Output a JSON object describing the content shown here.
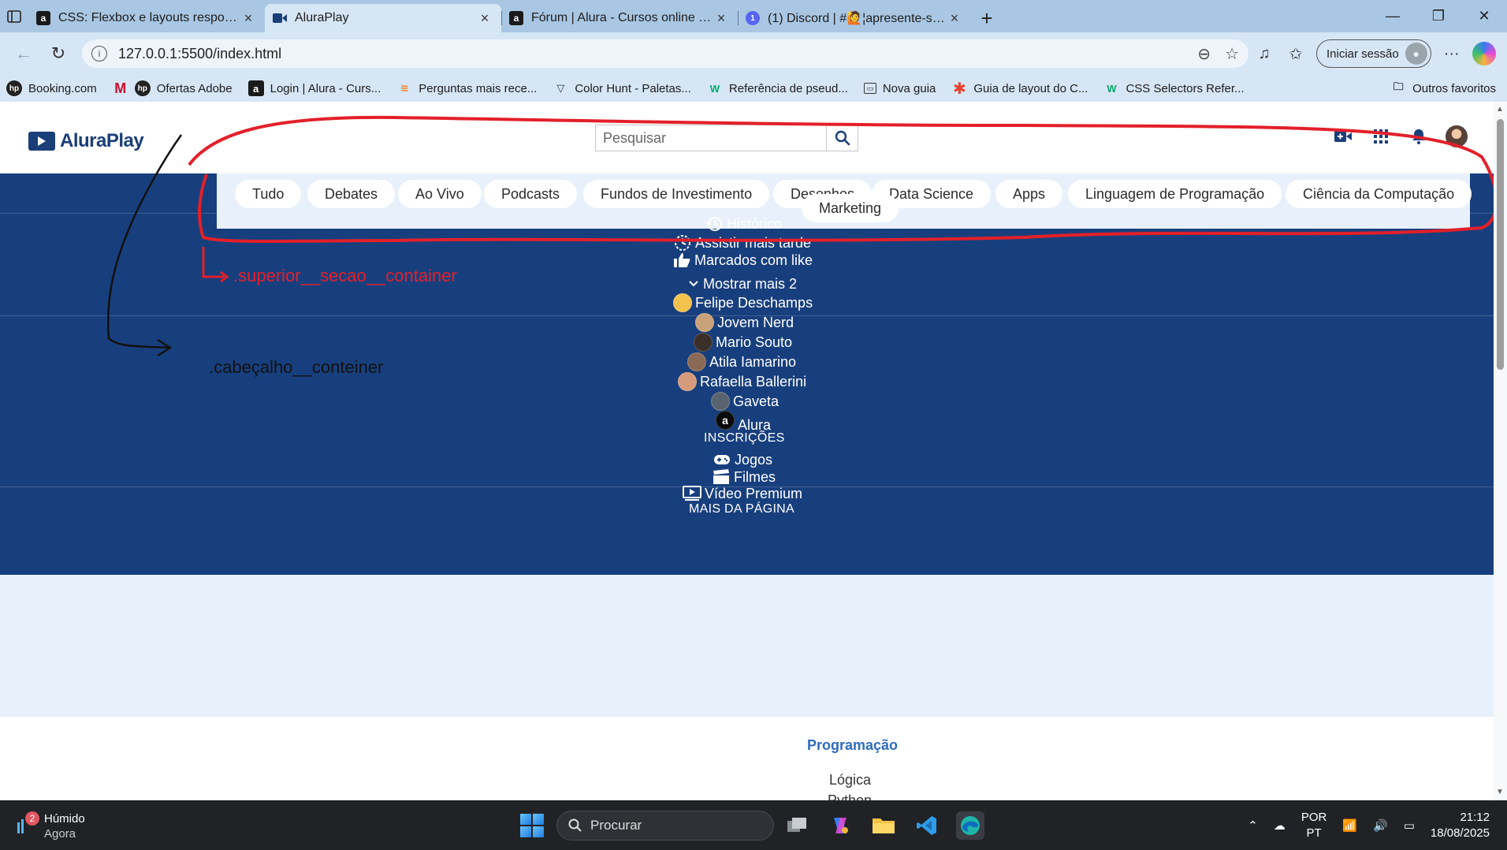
{
  "browser": {
    "tabs": [
      {
        "title": "CSS: Flexbox e layouts responsivo",
        "favicon": "alura-a-icon",
        "active": false
      },
      {
        "title": "AluraPlay",
        "favicon": "aluraplay-icon",
        "active": true
      },
      {
        "title": "Fórum | Alura - Cursos online de t",
        "favicon": "alura-a-icon",
        "active": false
      },
      {
        "title": "(1) Discord | #🙋¦apresente-se | A",
        "favicon": "discord-icon",
        "active": false
      }
    ],
    "url": "127.0.0.1:5500/index.html",
    "signin_label": "Iniciar sessão",
    "bookmarks": [
      {
        "label": "Booking.com",
        "icon": "hp-icon"
      },
      {
        "label": "Ofertas Adobe",
        "icon": "mcafee-icon"
      },
      {
        "label": "Login | Alura - Curs...",
        "icon": "hp-icon"
      },
      {
        "label": "Perguntas mais rece...",
        "icon": "alura-a-icon"
      },
      {
        "label": "Color Hunt - Paletas...",
        "icon": "stackoverflow-icon"
      },
      {
        "label": "Referência de pseud...",
        "icon": "colorhunt-icon"
      },
      {
        "label": "Nova guia",
        "icon": "w3schools-icon"
      },
      {
        "label": "Guia de layout do C...",
        "icon": "newtab-icon"
      },
      {
        "label": "CSS Selectors Refer...",
        "icon": "asterisk-icon"
      }
    ],
    "bookmarks_extra": {
      "label": "CSS Selectors Refer...",
      "icon": "w3schools-icon"
    },
    "other_favorites": "Outros favoritos"
  },
  "page": {
    "logo_text": "AluraPlay",
    "search_placeholder": "Pesquisar",
    "categories": [
      "Tudo",
      "Debates",
      "Ao Vivo",
      "Podcasts",
      "Fundos de Investimento",
      "Desenhos",
      "Data Science",
      "Apps",
      "Linguagem de Programação",
      "Ciência da Computação",
      "Marketing"
    ],
    "menu_top": [
      {
        "label": "Histórico",
        "icon": "history-icon"
      },
      {
        "label": "Assistir mais tarde",
        "icon": "clock-icon"
      },
      {
        "label": "Marcados com like",
        "icon": "thumbs-up-icon"
      }
    ],
    "show_more": "Mostrar mais 2",
    "subscriptions": [
      {
        "label": "Felipe Deschamps",
        "avatar_color": "#f2c14e"
      },
      {
        "label": "Jovem Nerd",
        "avatar_color": "#c9a27a"
      },
      {
        "label": "Mario Souto",
        "avatar_color": "#3b2f2a"
      },
      {
        "label": "Atila Iamarino",
        "avatar_color": "#8a6a55"
      },
      {
        "label": "Rafaella Ballerini",
        "avatar_color": "#d49a7a"
      },
      {
        "label": "Gaveta",
        "avatar_color": "#5a6470"
      },
      {
        "label": "Alura",
        "avatar_color": "#0b0b0b"
      }
    ],
    "subscriptions_title": "INSCRIÇÕES",
    "more_items": [
      {
        "label": "Jogos",
        "icon": "gamepad-icon"
      },
      {
        "label": "Filmes",
        "icon": "clapperboard-icon"
      },
      {
        "label": "Vídeo Premium",
        "icon": "video-premium-icon"
      }
    ],
    "more_title": "MAIS DA PÁGINA",
    "footer": {
      "title": "Programação",
      "links": [
        "Lógica",
        "Python"
      ]
    }
  },
  "annotations": {
    "red_label": ".superior__secao__container",
    "black_label": ".cabeçalho__conteiner",
    "red_color": "#e3202a"
  },
  "taskbar": {
    "weather_label": "Húmido",
    "weather_sub": "Agora",
    "weather_badge": "2",
    "search_placeholder": "Procurar",
    "lang_top": "POR",
    "lang_bottom": "PT",
    "time": "21:12",
    "date": "18/08/2025"
  },
  "colors": {
    "header_blue": "#183f7d",
    "chip_bg": "#ffffff",
    "category_bar": "#e8f1fb",
    "footer_title": "#2e6bbd"
  }
}
